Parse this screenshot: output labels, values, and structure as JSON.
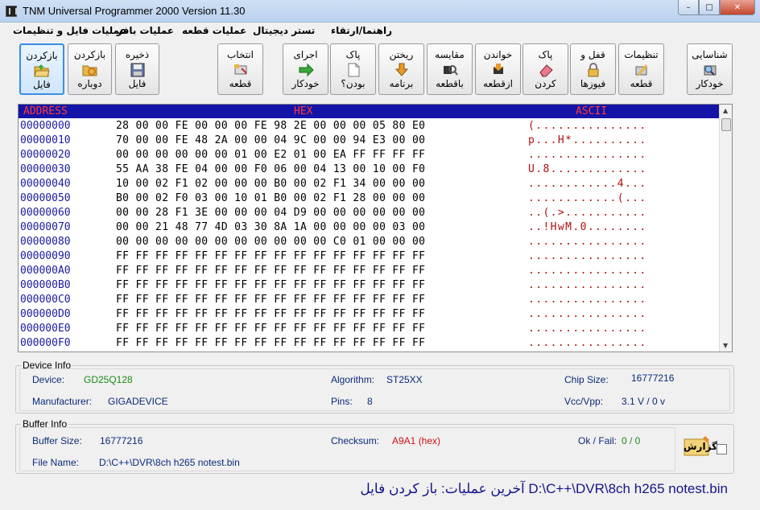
{
  "window": {
    "title": "TNM  Universal Programmer 2000   Version 11.30",
    "minimize_glyph": "–",
    "maximize_glyph": "□",
    "close_glyph": "✕"
  },
  "menu": [
    {
      "label": "راهنما/ارتقاء"
    },
    {
      "label": "تستر دیجیتال"
    },
    {
      "label": "عملیات قطعه"
    },
    {
      "label": "عملیات بافر"
    },
    {
      "label": "عملیات فایل و تنظیمات"
    }
  ],
  "toolbar": {
    "reload_file": {
      "line1": "بازکردن",
      "line2": "فایل",
      "icon": "open-folder-icon"
    },
    "reopen": {
      "line1": "بازکردن",
      "line2": "دوباره",
      "icon": "reload-icon"
    },
    "save_file": {
      "line1": "ذخیره",
      "line2": "فایل",
      "icon": "floppy-disk-icon"
    },
    "select_chip": {
      "line1": "انتخاب",
      "line2": "قطعه",
      "icon": "chip-select-icon"
    },
    "auto_run": {
      "line1": "اجرای",
      "line2": "خودکار",
      "icon": "play-arrow-icon"
    },
    "blank_check": {
      "line1": "پاک",
      "line2": "بودن؟",
      "icon": "blank-page-icon"
    },
    "program": {
      "line1": "ریختن",
      "line2": "برنامه",
      "icon": "download-arrow-icon"
    },
    "verify": {
      "line1": "مقایسه",
      "line2": "باقطعه",
      "icon": "compare-icon"
    },
    "read": {
      "line1": "خواندن",
      "line2": "ازقطعه",
      "icon": "read-chip-icon"
    },
    "erase": {
      "line1": "پاک",
      "line2": "کردن",
      "icon": "eraser-icon"
    },
    "lock_fuses": {
      "line1": "قفل و",
      "line2": "فیوزها",
      "icon": "lock-icon"
    },
    "chip_settings": {
      "line1": "تنظیمات",
      "line2": "قطعه",
      "icon": "settings-chip-icon"
    },
    "auto_detect": {
      "line1": "شناسایی",
      "line2": "خودکار",
      "icon": "detect-chip-icon"
    }
  },
  "hex_view": {
    "header": {
      "address": "ADDRESS",
      "hex": "HEX",
      "ascii": "ASCII"
    },
    "rows": [
      {
        "addr": "00000000",
        "bytes": "28 00 00 FE 00 00 00 FE 98 2E 00 00 00 05 80 E0",
        "ascii": "(..............."
      },
      {
        "addr": "00000010",
        "bytes": "70 00 00 FE 48 2A 00 00 04 9C 00 00 94 E3 00 00",
        "ascii": "p...H*.........."
      },
      {
        "addr": "00000020",
        "bytes": "00 00 00 00 00 00 01 00 E2 01 00 EA FF FF FF FF",
        "ascii": "................"
      },
      {
        "addr": "00000030",
        "bytes": "55 AA 38 FE 04 00 00 F0 06 00 04 13 00 10 00 F0",
        "ascii": "U.8............."
      },
      {
        "addr": "00000040",
        "bytes": "10 00 02 F1 02 00 00 00 B0 00 02 F1 34 00 00 00",
        "ascii": "............4..."
      },
      {
        "addr": "00000050",
        "bytes": "B0 00 02 F0 03 00 10 01 B0 00 02 F1 28 00 00 00",
        "ascii": "............(..."
      },
      {
        "addr": "00000060",
        "bytes": "00 00 28 F1 3E 00 00 00 04 D9 00 00 00 00 00 00",
        "ascii": "..(.>..........."
      },
      {
        "addr": "00000070",
        "bytes": "00 00 21 48 77 4D 03 30 8A 1A 00 00 00 00 03 00",
        "ascii": "..!HwM.0........"
      },
      {
        "addr": "00000080",
        "bytes": "00 00 00 00 00 00 00 00 00 00 00 C0 01 00 00 00",
        "ascii": "................"
      },
      {
        "addr": "00000090",
        "bytes": "FF FF FF FF FF FF FF FF FF FF FF FF FF FF FF FF",
        "ascii": "................"
      },
      {
        "addr": "000000A0",
        "bytes": "FF FF FF FF FF FF FF FF FF FF FF FF FF FF FF FF",
        "ascii": "................"
      },
      {
        "addr": "000000B0",
        "bytes": "FF FF FF FF FF FF FF FF FF FF FF FF FF FF FF FF",
        "ascii": "................"
      },
      {
        "addr": "000000C0",
        "bytes": "FF FF FF FF FF FF FF FF FF FF FF FF FF FF FF FF",
        "ascii": "................"
      },
      {
        "addr": "000000D0",
        "bytes": "FF FF FF FF FF FF FF FF FF FF FF FF FF FF FF FF",
        "ascii": "................"
      },
      {
        "addr": "000000E0",
        "bytes": "FF FF FF FF FF FF FF FF FF FF FF FF FF FF FF FF",
        "ascii": "................"
      },
      {
        "addr": "000000F0",
        "bytes": "FF FF FF FF FF FF FF FF FF FF FF FF FF FF FF FF",
        "ascii": "................"
      }
    ]
  },
  "device_info": {
    "title": "Device Info",
    "device_label": "Device:",
    "device_value": "GD25Q128",
    "algorithm_label": "Algorithm:",
    "algorithm_value": "ST25XX",
    "chip_size_label": "Chip Size:",
    "chip_size_value": "16777216",
    "manufacturer_label": "Manufacturer:",
    "manufacturer_value": "GIGADEVICE",
    "pins_label": "Pins:",
    "pins_value": "8",
    "vcc_label": "Vcc/Vpp:",
    "vcc_value": "3.1 V / 0 v"
  },
  "buffer_info": {
    "title": "Buffer Info",
    "size_label": "Buffer Size:",
    "size_value": "16777216",
    "checksum_label": "Checksum:",
    "checksum_value": "A9A1 (hex)",
    "okfail_label": "Ok / Fail:",
    "okfail_value": "0 / 0",
    "filename_label": "File Name:",
    "filename_value": "D:\\C++\\DVR\\8ch h265 notest.bin",
    "report_label": "گزارش"
  },
  "status": {
    "last_op_text": "آخرین عملیات:  باز کردن فایل  D:\\C++\\DVR\\8ch h265 notest.bin"
  },
  "colors": {
    "hex_header_bg": "#1414a8",
    "hex_header_text": "#ff3a3a",
    "address_text": "#1a1aa0",
    "ascii_text": "#b01010",
    "device_value": "#1a8a1a",
    "checksum_value": "#d01010"
  }
}
